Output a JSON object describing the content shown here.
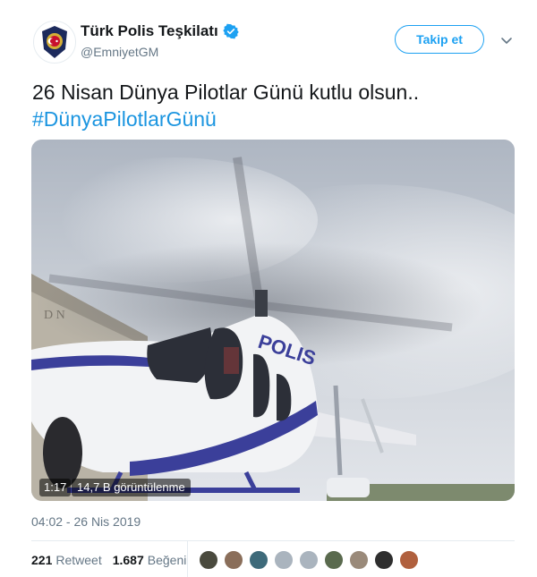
{
  "account": {
    "name": "Türk Polis Teşkilatı",
    "handle": "@EmniyetGM",
    "follow_label": "Takip et"
  },
  "tweet": {
    "text": "26 Nisan Dünya Pilotlar Günü kutlu olsun..",
    "hashtag": "#DünyaPilotlarGünü",
    "timestamp": "04:02 - 26 Nis 2019"
  },
  "video": {
    "duration": "1:17",
    "views": "14,7 B görüntülenme",
    "helicopter_text": "POLIS"
  },
  "stats": {
    "retweet_count": "221",
    "retweet_label": "Retweet",
    "like_count": "1.687",
    "like_label": "Beğeni"
  },
  "likers": [
    {
      "color": "#4a4a3e"
    },
    {
      "color": "#8a6e5a"
    },
    {
      "color": "#3e6a7a"
    },
    {
      "color": "#aab4be"
    },
    {
      "color": "#aab4be"
    },
    {
      "color": "#5a6a4e"
    },
    {
      "color": "#9a8a7a"
    },
    {
      "color": "#2e2e2e"
    },
    {
      "color": "#b0603e"
    }
  ],
  "colors": {
    "accent": "#1da1f2",
    "link": "#1b95e0",
    "muted": "#657786"
  }
}
